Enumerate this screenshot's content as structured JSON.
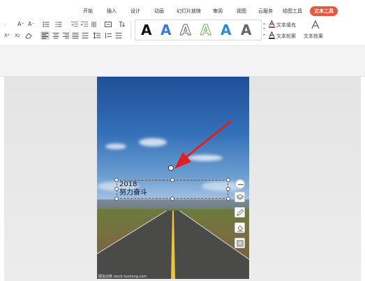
{
  "tabs": [
    {
      "label": "开始",
      "active": false
    },
    {
      "label": "插入",
      "active": false
    },
    {
      "label": "设计",
      "active": false
    },
    {
      "label": "动画",
      "active": false
    },
    {
      "label": "幻灯片放映",
      "active": false
    },
    {
      "label": "审阅",
      "active": false
    },
    {
      "label": "视图",
      "active": false
    },
    {
      "label": "云服务",
      "active": false
    },
    {
      "label": "绘图工具",
      "active": false
    },
    {
      "label": "文本工具",
      "active": true
    }
  ],
  "ribbon": {
    "font_grow": "A⁺",
    "font_shrink": "A⁻",
    "superscript": "X²",
    "subscript": "X₂",
    "text_fill_label": "文本填充",
    "text_outline_label": "文本轮廓",
    "text_effect_label": "文本效果",
    "gallery_letter": "A",
    "accent_color": "#e9573f"
  },
  "slide": {
    "textbox_line1": "2018",
    "textbox_line2": "努力奋斗",
    "watermark": "图虫创意 stock.tuchong.com"
  },
  "icons": {
    "arrow": "red-pointer-arrow",
    "float_toolbar": [
      "minus-circle-icon",
      "layers-icon",
      "pen-icon",
      "shape-fill-icon",
      "border-icon"
    ]
  }
}
